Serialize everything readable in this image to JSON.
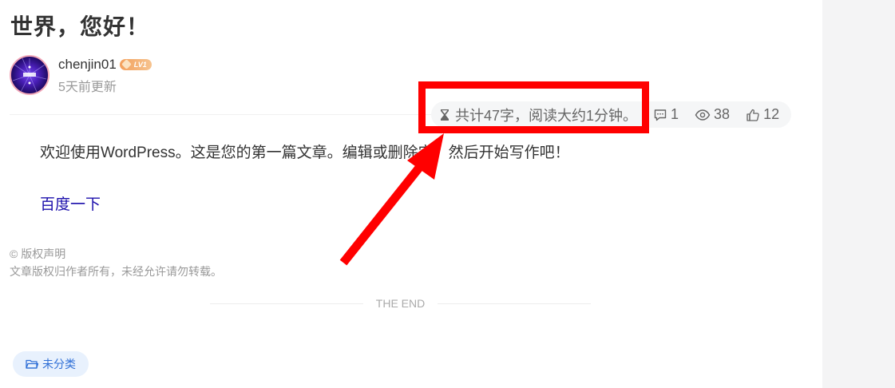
{
  "post": {
    "title": "世界，您好！",
    "author": {
      "name": "chenjin01",
      "level": "LV1",
      "updated": "5天前更新"
    },
    "stats": {
      "words_text": "共计47字，阅读大约1分钟。",
      "comments": "1",
      "views": "38",
      "likes": "12"
    },
    "content": {
      "paragraph": "欢迎使用WordPress。这是您的第一篇文章。编辑或删除它，然后开始写作吧！",
      "link_text": "百度一下"
    },
    "copyright": {
      "heading": "© 版权声明",
      "text": "文章版权归作者所有，未经允许请勿转载。"
    },
    "the_end": "THE END",
    "category": "未分类"
  },
  "annotation": {
    "highlight_color": "#ff0000"
  },
  "colors": {
    "link": "#1a0dab",
    "category_bg": "#e8f1fd",
    "category_text": "#2f6fd6",
    "level_badge": "#f3a05c"
  },
  "icons": [
    "hourglass-icon",
    "comment-icon",
    "eye-icon",
    "thumbs-up-icon",
    "folder-icon",
    "gem-icon"
  ]
}
